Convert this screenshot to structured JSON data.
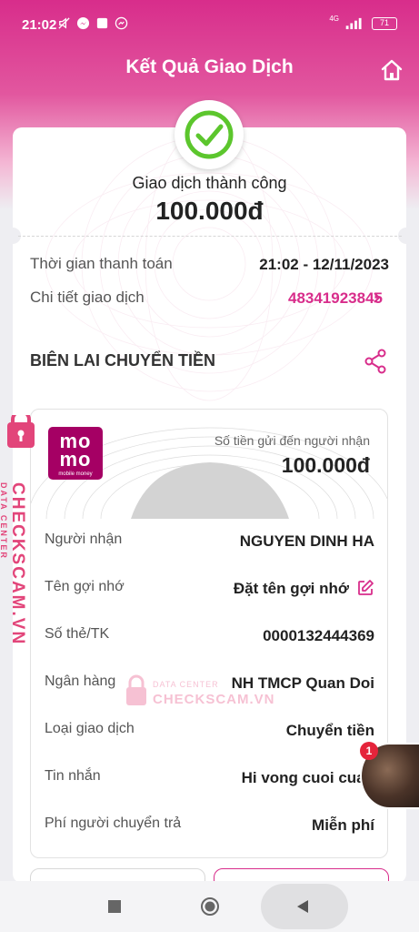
{
  "status_bar": {
    "time": "21:02",
    "network": "4G",
    "battery": "71"
  },
  "header": {
    "title": "Kết Quả Giao Dịch"
  },
  "result": {
    "status_label": "Giao dịch thành công",
    "amount": "100.000đ",
    "rows": [
      {
        "label": "Thời gian thanh toán",
        "value": "21:02 - 12/11/2023"
      },
      {
        "label": "Chi tiết giao dịch",
        "value": "48341923845"
      }
    ]
  },
  "receipt": {
    "section_title": "BIÊN LAI CHUYỂN TIỀN",
    "logo_text": "mo mo",
    "logo_subtext": "mobile money",
    "caption": "Số tiền gửi đến người nhận",
    "amount": "100.000đ",
    "rows": [
      {
        "label": "Người nhận",
        "value": "NGUYEN DINH HA"
      },
      {
        "label": "Tên gợi nhớ",
        "value": "Đặt tên gợi nhớ"
      },
      {
        "label": "Số thẻ/TK",
        "value": "0000132444369"
      },
      {
        "label": "Ngân hàng",
        "value": "NH TMCP Quan Doi"
      },
      {
        "label": "Loại giao dịch",
        "value": "Chuyển tiền"
      },
      {
        "label": "Tin nhắn",
        "value": "Hi vong cuoi cua t"
      },
      {
        "label": "Phí người chuyển trả",
        "value": "Miễn phí"
      }
    ]
  },
  "watermark": {
    "side_brand": "CHECKSCAM.VN",
    "side_tag": "DATA CENTER",
    "center_tag": "DATA CENTER",
    "center_brand": "CHECKSCAM.VN"
  },
  "chat_head": {
    "badge_count": "1"
  },
  "colors": {
    "brand": "#d82d8b",
    "momo": "#a50064",
    "success": "#5cc62d"
  }
}
